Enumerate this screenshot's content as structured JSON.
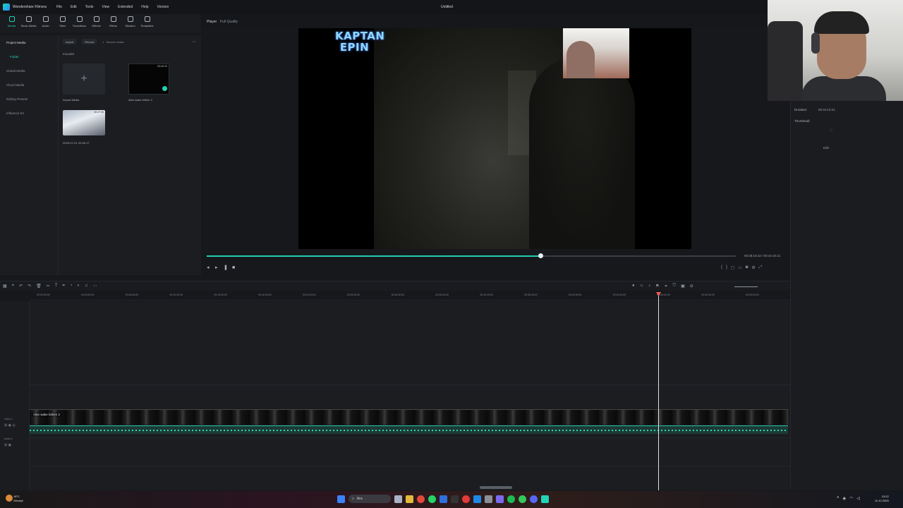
{
  "titlebar": {
    "app_name": "Wondershare Filmora",
    "menu": [
      "File",
      "Edit",
      "Tools",
      "View",
      "Extended",
      "Help",
      "Version"
    ],
    "doc_title": "Untitled"
  },
  "toolbar": {
    "tabs": [
      "Media",
      "Stock Media",
      "Audio",
      "Titles",
      "Transitions",
      "Effects",
      "Filters",
      "Stickers",
      "Templates"
    ]
  },
  "sidebar": {
    "items": [
      "Project Media",
      "Folder",
      "Global Media",
      "Cloud Media",
      "Editing Presets",
      "Influence Kit"
    ]
  },
  "media": {
    "import_label": "Import",
    "record_label": "Record",
    "search_placeholder": "Search media",
    "folder_label": "FOLDER",
    "import_tile_label": "Import Media",
    "clip1_label": "Alan wake bölüm 2",
    "clip1_duration": "00:44:10",
    "clip2_label": "2025-07-21 22-55-17",
    "clip2_duration": "00:17:08"
  },
  "player": {
    "label": "Player",
    "quality": "Full Quality",
    "overlay_logo": "KAPTAN EPIN",
    "progress": 0.63,
    "current_time": "00:28:15:42",
    "total_time": "/ 00:44:10:21"
  },
  "properties": {
    "duration_label": "Duration:",
    "duration_value": "00:44:10:21",
    "thumbnail_label": "Thumbnail:",
    "edit_label": "Edit"
  },
  "timeline": {
    "ticks": [
      "00:00:00:00",
      "00:03:20:00",
      "00:06:40:00",
      "00:10:00:00",
      "00:13:20:00",
      "00:16:40:00",
      "00:20:00:00",
      "00:23:20:00",
      "00:26:40:00",
      "00:30:00:00",
      "00:33:20:00",
      "00:36:40:00",
      "00:40:00:00",
      "00:43:20:00",
      "00:46:40:00",
      "00:50:00:00",
      "00:53:20:00"
    ],
    "video_track_label": "Video 1",
    "audio_track_label": "Audio 1",
    "clip_label": "Alan wake bölüm 2"
  },
  "taskbar": {
    "weather_temp": "18°C",
    "weather_desc": "Güneşli",
    "search_label": "Ara",
    "time": "13:22",
    "date": "11.10.2025"
  }
}
